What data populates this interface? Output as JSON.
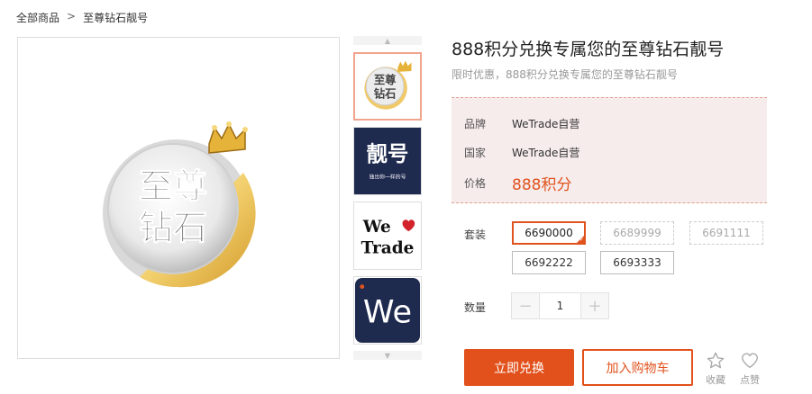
{
  "breadcrumb": {
    "root": "全部商品",
    "separator": ">",
    "current": "至尊钻石靓号"
  },
  "product": {
    "title": "888积分兑换专属您的至尊钻石靓号",
    "subtitle": "限时优惠，888积分兑换专属您的至尊钻石靓号",
    "image_text_top": "至尊",
    "image_text_bottom": "钻石"
  },
  "thumbnails": [
    {
      "name": "diamond-badge",
      "active": true,
      "text_top": "至尊",
      "text_bottom": "钻石"
    },
    {
      "name": "liang-hao",
      "active": false,
      "text": "靓号",
      "subtext": "独出你一样的号"
    },
    {
      "name": "we-trade",
      "active": false,
      "line1": "We",
      "line2": "Trade"
    },
    {
      "name": "we-logo",
      "active": false,
      "text": "We"
    }
  ],
  "info": {
    "brand_label": "品牌",
    "brand_value": "WeTrade自营",
    "country_label": "国家",
    "country_value": "WeTrade自营",
    "price_label": "价格",
    "price_value": "888积分"
  },
  "sku": {
    "label": "套装",
    "options": [
      {
        "value": "6690000",
        "state": "selected"
      },
      {
        "value": "6689999",
        "state": "disabled"
      },
      {
        "value": "6691111",
        "state": "disabled"
      },
      {
        "value": "6692222",
        "state": "available"
      },
      {
        "value": "6693333",
        "state": "available"
      }
    ]
  },
  "quantity": {
    "label": "数量",
    "value": "1",
    "minus": "−",
    "plus": "+"
  },
  "buttons": {
    "buy": "立即兑换",
    "cart": "加入购物车"
  },
  "actions": {
    "favorite": "收藏",
    "like": "点赞"
  },
  "colors": {
    "accent": "#e2511c",
    "info_bg": "#f7ecec",
    "gold": "#d9a83a",
    "navy": "#1f2a4f"
  }
}
